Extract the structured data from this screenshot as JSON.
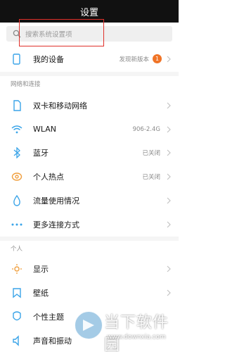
{
  "header": {
    "title": "设置"
  },
  "search": {
    "placeholder": "搜索系统设置项"
  },
  "device": {
    "label": "我的设备",
    "status": "发现新版本",
    "badge": "1"
  },
  "sections": {
    "network": "网络和连接",
    "personal": "个人"
  },
  "network_items": [
    {
      "label": "双卡和移动网络",
      "value": "",
      "icon": "sim-card-icon"
    },
    {
      "label": "WLAN",
      "value": "906-2.4G",
      "icon": "wifi-icon"
    },
    {
      "label": "蓝牙",
      "value": "已关闭",
      "icon": "bluetooth-icon"
    },
    {
      "label": "个人热点",
      "value": "已关闭",
      "icon": "hotspot-icon"
    },
    {
      "label": "流量使用情况",
      "value": "",
      "icon": "data-usage-icon"
    },
    {
      "label": "更多连接方式",
      "value": "",
      "icon": "more-connections-icon"
    }
  ],
  "personal_items": [
    {
      "label": "显示",
      "icon": "display-icon"
    },
    {
      "label": "壁纸",
      "icon": "wallpaper-icon"
    },
    {
      "label": "个性主题",
      "icon": "theme-icon"
    },
    {
      "label": "声音和振动",
      "icon": "sound-icon"
    }
  ],
  "watermark": {
    "text": "当下软件园",
    "url": "www.downxia.com"
  },
  "colors": {
    "accent": "#f07427",
    "highlight": "#e0302a",
    "icon_blue": "#3aa4e8",
    "icon_orange": "#f0a040"
  }
}
